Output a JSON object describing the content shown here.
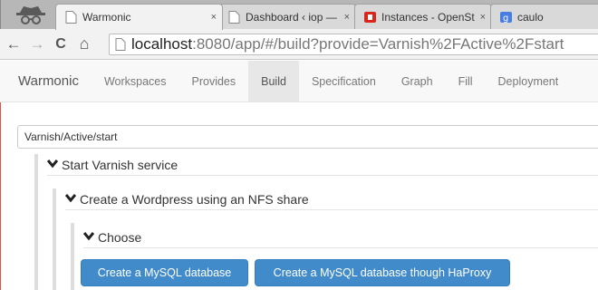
{
  "browser": {
    "tabs": [
      {
        "label": "Warmonic",
        "active": true,
        "close": "×"
      },
      {
        "label": "Dashboard ‹ iop — W",
        "close": "×"
      },
      {
        "label": "Instances - OpenStac",
        "close": "×"
      },
      {
        "label": "caulo",
        "close": ""
      }
    ],
    "url_host": "localhost",
    "url_path": ":8080/app/#/build?provide=Varnish%2FActive%2Fstart",
    "back_icon": "←",
    "forward_icon": "→",
    "reload_icon": "C",
    "home_icon": "⌂"
  },
  "navbar": {
    "brand": "Warmonic",
    "items": [
      "Workspaces",
      "Provides",
      "Build",
      "Specification",
      "Graph",
      "Fill",
      "Deployment"
    ],
    "active_item": "Build"
  },
  "build": {
    "path_value": "Varnish/Active/start",
    "nodes": [
      {
        "label": "Start Varnish service"
      },
      {
        "label": "Create a Wordpress using an NFS share"
      },
      {
        "label": "Choose"
      }
    ],
    "chevron": "❤",
    "buttons": [
      "Create a MySQL database",
      "Create a MySQL database though HaProxy"
    ]
  },
  "colors": {
    "primary_button": "#428bca",
    "navbar_bg": "#f8f8f8",
    "accent_line": "#d9534f"
  }
}
